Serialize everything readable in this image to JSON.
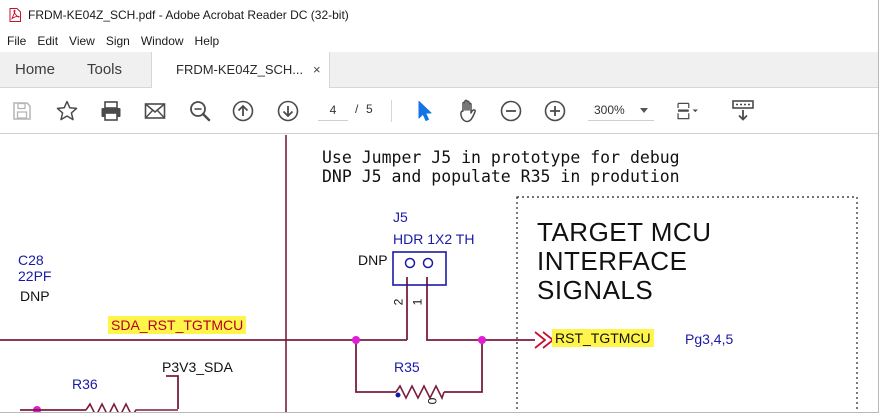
{
  "window": {
    "title": "FRDM-KE04Z_SCH.pdf - Adobe Acrobat Reader DC (32-bit)"
  },
  "menu": [
    "File",
    "Edit",
    "View",
    "Sign",
    "Window",
    "Help"
  ],
  "tabs": {
    "home": "Home",
    "tools": "Tools",
    "document": "FRDM-KE04Z_SCH...",
    "close": "×"
  },
  "toolbar": {
    "current_page": "4",
    "page_separator": "/",
    "total_pages": "5",
    "zoom": "300%",
    "icons": [
      "save-icon",
      "bookmark-star-icon",
      "print-icon",
      "email-icon",
      "search-icon",
      "page-up-icon",
      "page-down-icon",
      "select-cursor-icon",
      "hand-tool-icon",
      "zoom-out-icon",
      "zoom-in-icon",
      "page-fit-icon",
      "keyboard-tools-icon"
    ],
    "accent_color": "#1473e6"
  },
  "schematic": {
    "note_line1": "Use Jumper J5 in prototype for debug",
    "note_line2": "DNP J5 and populate R35 in prodution",
    "capacitor_ref": "C28",
    "capacitor_value": "22PF",
    "capacitor_dnp": "DNP",
    "jumper_ref": "J5",
    "jumper_type": "HDR 1X2 TH",
    "jumper_dnp": "DNP",
    "jumper_pin2": "2",
    "jumper_pin1": "1",
    "net_left": "SDA_RST_TGTMCU",
    "net_right": "RST_TGTMCU",
    "page_ref": "Pg3,4,5",
    "resistor_r35": "R35",
    "resistor_r35_value": "0",
    "resistor_r36": "R36",
    "power_net": "P3V3_SDA",
    "box_title_line1": "TARGET MCU",
    "box_title_line2": "INTERFACE",
    "box_title_line3": "SIGNALS",
    "wire_color": "#7a1d3f",
    "junction_color": "#e21cd6",
    "net_highlight_color": "#fff54a"
  }
}
